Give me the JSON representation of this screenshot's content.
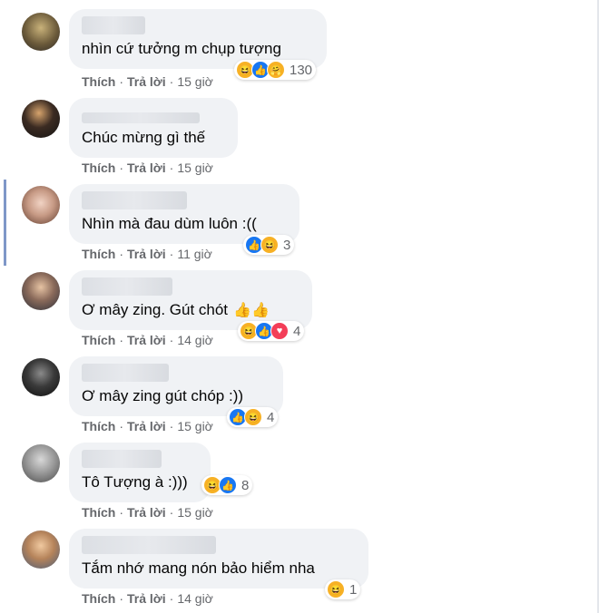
{
  "comments": [
    {
      "text": "nhìn cứ tưởng m chụp tượng",
      "like": "Thích",
      "reply": "Trả lời",
      "time": "15 giờ",
      "count": "130",
      "reactions": [
        "haha-icon",
        "like-icon",
        "care-icon"
      ]
    },
    {
      "text": "Chúc mừng gì thế",
      "like": "Thích",
      "reply": "Trả lời",
      "time": "15 giờ",
      "count": "",
      "reactions": []
    },
    {
      "text": "Nhìn mà đau dùm luôn :((",
      "like": "Thích",
      "reply": "Trả lời",
      "time": "11 giờ",
      "count": "3",
      "reactions": [
        "like-icon",
        "haha-icon"
      ]
    },
    {
      "text": "Ơ mây zing. Gút chót",
      "like": "Thích",
      "reply": "Trả lời",
      "time": "14 giờ",
      "count": "4",
      "reactions": [
        "haha-icon",
        "like-icon",
        "love-icon"
      ]
    },
    {
      "text": "Ơ mây zing gút chóp :))",
      "like": "Thích",
      "reply": "Trả lời",
      "time": "15 giờ",
      "count": "4",
      "reactions": [
        "like-icon",
        "haha-icon"
      ]
    },
    {
      "text": "Tô Tượng à :)))",
      "like": "Thích",
      "reply": "Trả lời",
      "time": "15 giờ",
      "count": "8",
      "reactions": [
        "haha-icon",
        "like-icon"
      ]
    },
    {
      "text": "Tắm nhớ mang nón bảo hiểm nha",
      "like": "Thích",
      "reply": "Trả lời",
      "time": "14 giờ",
      "count": "1",
      "reactions": [
        "haha-icon"
      ]
    }
  ],
  "colors": {
    "like": "#1877f2",
    "haha": "#f7b125",
    "love": "#f33e58",
    "bubble": "#f0f2f5",
    "meta": "#65676b"
  }
}
